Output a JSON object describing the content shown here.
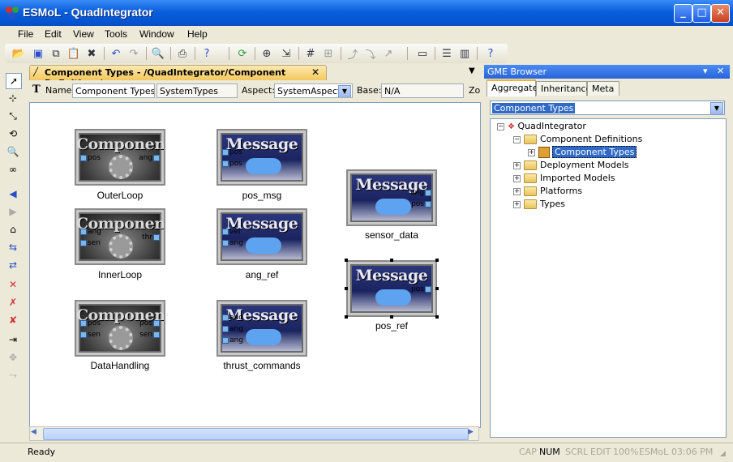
{
  "window": {
    "title": "ESMoL - QuadIntegrator",
    "min_glyph": "_",
    "max_glyph": "□",
    "close_glyph": "✕"
  },
  "menu": [
    "File",
    "Edit",
    "View",
    "Tools",
    "Window",
    "Help"
  ],
  "toolbar_icons": [
    "open-icon",
    "save-icon",
    "copy-icon",
    "paste-icon",
    "delete-icon",
    "undo-icon",
    "redo-icon",
    "find-icon",
    "print-icon",
    "help-icon",
    "refresh-icon",
    "zoom-icon",
    "zoom-fit-icon",
    "grid-icon",
    "layout-icon",
    "connect-icon",
    "connect-alt-icon",
    "connect-more-icon",
    "panel-icon",
    "split-h-icon",
    "split-v-icon",
    "about-icon"
  ],
  "palette_icons": [
    "pointer-icon",
    "zoom-region-icon",
    "connect-mode-icon",
    "set-mode-icon",
    "zoom-mode-icon",
    "visualize-icon",
    "back-icon",
    "forward-icon",
    "home-icon",
    "cycle-aspect-icon",
    "cycle-all-icon",
    "delete-mode-icon",
    "disconnect-icon",
    "delete-connection-icon",
    "insert-icon",
    "move-icon",
    "reroute-icon"
  ],
  "editor": {
    "tab_title": "Component Types - /QuadIntegrator/Component Definitions/",
    "tab_close": "✕",
    "name_label": "Name:",
    "name_value": "Component Types",
    "kind_value": "SystemTypes",
    "aspect_label": "Aspect:",
    "aspect_value": "SystemAspect",
    "base_label": "Base:",
    "base_value": "N/A",
    "zoom_label": "Zo"
  },
  "blocks": [
    {
      "kind": "Component",
      "label": "OuterLoop",
      "in_ports": [
        "pos"
      ],
      "out_ports": [
        "ang"
      ]
    },
    {
      "kind": "Message",
      "label": "pos_msg",
      "in_ports": [
        "pos",
        "pos"
      ],
      "out_ports": []
    },
    {
      "kind": "Message",
      "label": "sensor_data",
      "in_ports": [],
      "out_ports": [
        "ang",
        "pos"
      ]
    },
    {
      "kind": "Component",
      "label": "InnerLoop",
      "in_ports": [
        "ang",
        "sen"
      ],
      "out_ports": [
        "thr"
      ]
    },
    {
      "kind": "Message",
      "label": "ang_ref",
      "in_ports": [
        "vel",
        "ang"
      ],
      "out_ports": []
    },
    {
      "kind": "Message",
      "label": "pos_ref",
      "in_ports": [],
      "out_ports": [
        "pos"
      ]
    },
    {
      "kind": "Component",
      "label": "DataHandling",
      "in_ports": [
        "pos",
        "sen"
      ],
      "out_ports": [
        "pos",
        "sen"
      ]
    },
    {
      "kind": "Message",
      "label": "thrust_commands",
      "in_ports": [
        "ang",
        "ang",
        "ang"
      ],
      "out_ports": []
    }
  ],
  "browser": {
    "title": "GME Browser",
    "pin_glyph": "▾",
    "close_glyph": "✕",
    "tabs": [
      "Aggregate",
      "Inheritance",
      "Meta"
    ],
    "combo_value": "Component Types",
    "tree": {
      "root": "QuadIntegrator",
      "component_definitions": "Component Definitions",
      "component_types": "Component Types",
      "deployment_models": "Deployment Models",
      "imported_models": "Imported Models",
      "platforms": "Platforms",
      "types": "Types"
    }
  },
  "status": {
    "ready": "Ready",
    "cap": "CAP",
    "num": "NUM",
    "scrl": "SCRL",
    "edit": "EDIT",
    "zoom": "100%",
    "app": "ESMoL",
    "time": "03:06  PM"
  }
}
